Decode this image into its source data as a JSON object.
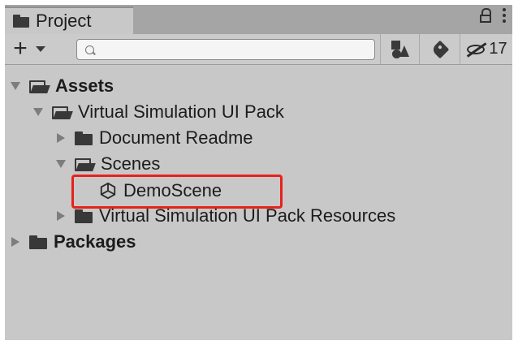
{
  "window": {
    "tab_label": "Project"
  },
  "toolbar": {
    "add_label": "+",
    "search_value": "",
    "hidden_count": "17"
  },
  "tree": {
    "items": [
      {
        "label": "Assets",
        "expanded": true,
        "bold": true,
        "type": "folder"
      },
      {
        "label": "Virtual Simulation UI Pack",
        "expanded": true,
        "bold": false,
        "type": "folder"
      },
      {
        "label": "Document Readme",
        "expanded": false,
        "bold": false,
        "type": "folder"
      },
      {
        "label": "Scenes",
        "expanded": true,
        "bold": false,
        "type": "folder"
      },
      {
        "label": "DemoScene",
        "bold": false,
        "type": "scene",
        "highlighted": true
      },
      {
        "label": "Virtual Simulation UI Pack Resources",
        "expanded": false,
        "bold": false,
        "type": "folder"
      },
      {
        "label": "Packages",
        "expanded": false,
        "bold": true,
        "type": "folder"
      }
    ]
  },
  "colors": {
    "panel_bg": "#c8c8c8",
    "highlight_border": "#e8211b"
  }
}
